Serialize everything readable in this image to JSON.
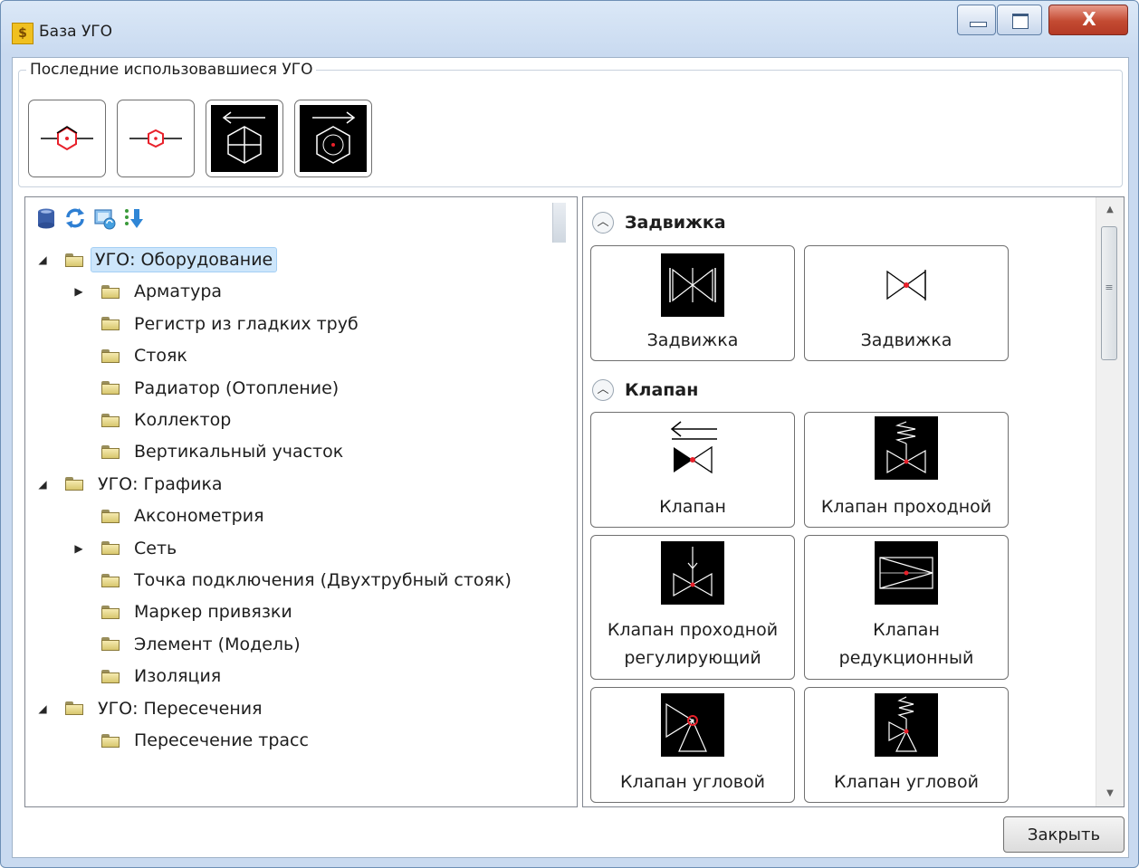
{
  "window": {
    "title": "База УГО",
    "app_icon": "ssss-app-icon",
    "controls": [
      "minimize-icon",
      "maximize-icon",
      "close-icon"
    ]
  },
  "recent": {
    "title": "Последние использовавшиеся УГО",
    "items": [
      {
        "icon": "pump-symbol-red-icon",
        "style": "light"
      },
      {
        "icon": "pump-symbol-red-small-icon",
        "style": "light"
      },
      {
        "icon": "hexagon-cross-arrow-left-icon",
        "style": "dark"
      },
      {
        "icon": "hexagon-dot-arrow-right-icon",
        "style": "dark"
      }
    ]
  },
  "toolbar": {
    "icons": [
      "database-icon",
      "refresh-icon",
      "sync-image-icon",
      "sort-download-icon"
    ]
  },
  "tree": {
    "groups": [
      {
        "label": "УГО: Оборудование",
        "expanded": true,
        "selected": true,
        "children": [
          {
            "label": "Арматура",
            "has_children": true
          },
          {
            "label": "Регистр из гладких труб"
          },
          {
            "label": "Стояк"
          },
          {
            "label": "Радиатор (Отопление)"
          },
          {
            "label": "Коллектор"
          },
          {
            "label": "Вертикальный участок"
          }
        ]
      },
      {
        "label": "УГО: Графика",
        "expanded": true,
        "children": [
          {
            "label": "Аксонометрия"
          },
          {
            "label": "Сеть",
            "has_children": true
          },
          {
            "label": "Точка подключения (Двухтрубный стояк)"
          },
          {
            "label": "Маркер привязки"
          },
          {
            "label": "Элемент (Модель)"
          },
          {
            "label": "Изоляция"
          }
        ]
      },
      {
        "label": "УГО: Пересечения",
        "expanded": true,
        "children": [
          {
            "label": "Пересечение трасс"
          }
        ]
      }
    ]
  },
  "gallery": {
    "sections": [
      {
        "title": "Задвижка",
        "items": [
          {
            "caption": [
              "Задвижка"
            ],
            "icon": "gate-valve-black-icon"
          },
          {
            "caption": [
              "Задвижка"
            ],
            "icon": "gate-valve-outline-icon"
          }
        ]
      },
      {
        "title": "Клапан",
        "items": [
          {
            "caption": [
              "Клапан"
            ],
            "icon": "valve-arrow-icon"
          },
          {
            "caption": [
              "Клапан проходной"
            ],
            "icon": "valve-pass-spring-icon"
          },
          {
            "caption": [
              "Клапан проходной",
              "регулирующий"
            ],
            "icon": "valve-regulating-icon"
          },
          {
            "caption": [
              "Клапан",
              "редукционный"
            ],
            "icon": "valve-reduction-icon"
          },
          {
            "caption": [
              "Клапан угловой"
            ],
            "icon": "valve-angle-icon"
          },
          {
            "caption": [
              "Клапан угловой"
            ],
            "icon": "valve-angle-spring-icon"
          }
        ]
      }
    ]
  },
  "footer": {
    "close_label": "Закрыть"
  },
  "colors": {
    "accent_red": "#e8202a",
    "selection": "#cde6fb",
    "titlebar": "#c9daf0",
    "close_red": "#c34a32"
  }
}
